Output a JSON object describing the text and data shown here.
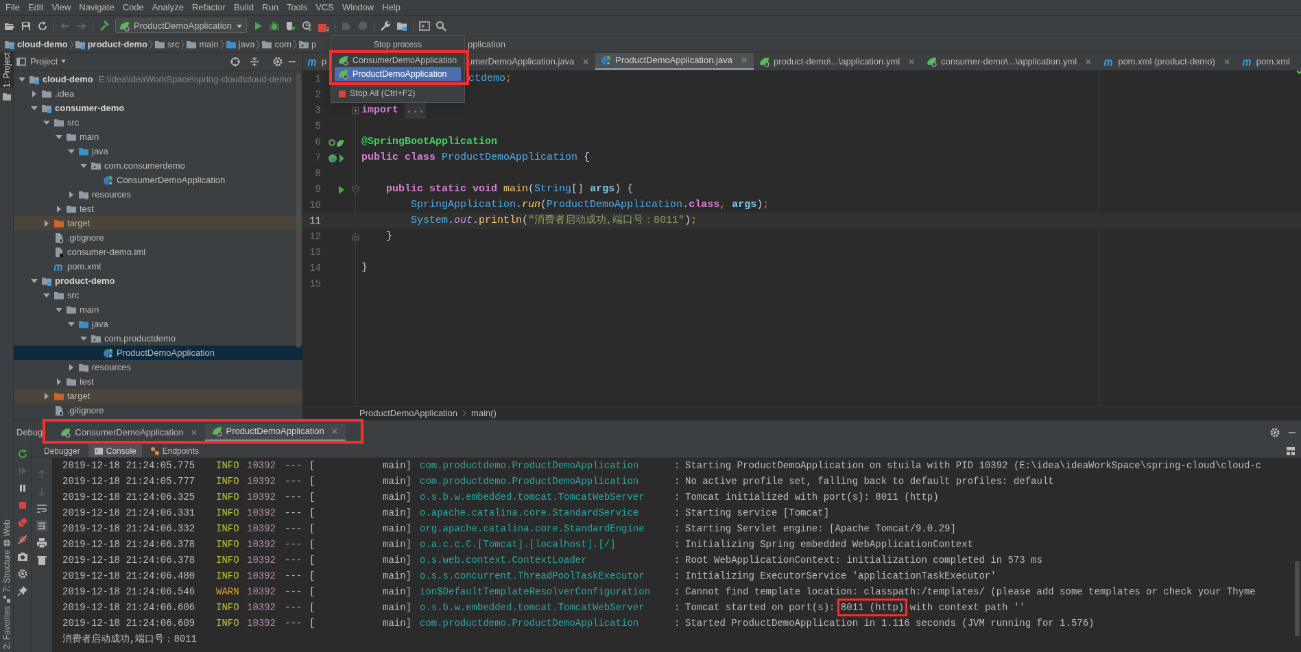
{
  "menu": [
    "File",
    "Edit",
    "View",
    "Navigate",
    "Code",
    "Analyze",
    "Refactor",
    "Build",
    "Run",
    "Tools",
    "VCS",
    "Window",
    "Help"
  ],
  "toolbar": {
    "run_config": "ProductDemoApplication",
    "stop_badge": "2"
  },
  "breadcrumbs": [
    {
      "label": "cloud-demo",
      "kind": "module"
    },
    {
      "label": "product-demo",
      "kind": "module"
    },
    {
      "label": "src",
      "kind": "folder"
    },
    {
      "label": "main",
      "kind": "folder"
    },
    {
      "label": "java",
      "kind": "source"
    },
    {
      "label": "com",
      "kind": "folder"
    },
    {
      "label": "p",
      "kind": "package"
    }
  ],
  "breadcrumb_tail": "pplication",
  "left_tool_windows": {
    "top": [
      {
        "label": "1: Project",
        "selected": true
      }
    ],
    "bottom": [
      {
        "label": "Web",
        "selected": false
      },
      {
        "label": "7: Structure",
        "selected": false
      },
      {
        "label": "2: Favorites",
        "selected": false
      }
    ]
  },
  "project": {
    "title": "Project",
    "tree": [
      {
        "kind": "module",
        "label": "cloud-demo",
        "path": "E:\\idea\\ideaWorkSpace\\spring-cloud\\cloud-demo",
        "expanded": true,
        "selected": false,
        "children": [
          {
            "kind": "folder",
            "label": ".idea",
            "expanded": false,
            "selected": false
          },
          {
            "kind": "module",
            "label": "consumer-demo",
            "expanded": true,
            "selected": false,
            "children": [
              {
                "kind": "folder",
                "label": "src",
                "expanded": true,
                "selected": false,
                "children": [
                  {
                    "kind": "folder",
                    "label": "main",
                    "expanded": true,
                    "selected": false,
                    "children": [
                      {
                        "kind": "source",
                        "label": "java",
                        "expanded": true,
                        "selected": false,
                        "children": [
                          {
                            "kind": "package",
                            "label": "com.consumerdemo",
                            "expanded": true,
                            "selected": false,
                            "children": [
                              {
                                "kind": "app",
                                "label": "ConsumerDemoApplication",
                                "selected": false
                              }
                            ]
                          }
                        ]
                      },
                      {
                        "kind": "resources",
                        "label": "resources",
                        "expanded": false,
                        "selected": false
                      }
                    ]
                  },
                  {
                    "kind": "folder",
                    "label": "test",
                    "expanded": false,
                    "selected": false
                  }
                ]
              },
              {
                "kind": "excluded",
                "label": "target",
                "expanded": false,
                "selected": false
              },
              {
                "kind": "ignore",
                "label": ".gitignore",
                "selected": false
              },
              {
                "kind": "iml",
                "label": "consumer-demo.iml",
                "selected": false
              },
              {
                "kind": "maven",
                "label": "pom.xml",
                "selected": false
              }
            ]
          },
          {
            "kind": "module",
            "label": "product-demo",
            "expanded": true,
            "selected": false,
            "children": [
              {
                "kind": "folder",
                "label": "src",
                "expanded": true,
                "selected": false,
                "children": [
                  {
                    "kind": "folder",
                    "label": "main",
                    "expanded": true,
                    "selected": false,
                    "children": [
                      {
                        "kind": "source",
                        "label": "java",
                        "expanded": true,
                        "selected": false,
                        "children": [
                          {
                            "kind": "package",
                            "label": "com.productdemo",
                            "expanded": true,
                            "selected": false,
                            "children": [
                              {
                                "kind": "app",
                                "label": "ProductDemoApplication",
                                "selected": true
                              }
                            ]
                          }
                        ]
                      },
                      {
                        "kind": "resources",
                        "label": "resources",
                        "expanded": false,
                        "selected": false
                      }
                    ]
                  },
                  {
                    "kind": "folder",
                    "label": "test",
                    "expanded": false,
                    "selected": false
                  }
                ]
              },
              {
                "kind": "excluded",
                "label": "target",
                "expanded": false,
                "selected": false
              },
              {
                "kind": "ignore",
                "label": ".gitignore",
                "selected": false
              }
            ]
          }
        ]
      }
    ]
  },
  "editor": {
    "tabs": [
      {
        "label": "p",
        "kind": "maven",
        "covered": true,
        "closable": false,
        "selected": false
      },
      {
        "label": "umerDemoApplication.java",
        "kind": "none",
        "covered": true,
        "closable": true,
        "selected": false
      },
      {
        "label": "ProductDemoApplication.java",
        "kind": "app",
        "covered": false,
        "closable": true,
        "selected": true
      },
      {
        "label": "product-demo\\...\\application.yml",
        "kind": "leaf",
        "covered": false,
        "closable": true,
        "selected": false
      },
      {
        "label": "consumer-demo\\...\\application.yml",
        "kind": "leaf",
        "covered": false,
        "closable": true,
        "selected": false
      },
      {
        "label": "pom.xml (product-demo)",
        "kind": "maven",
        "covered": false,
        "closable": true,
        "selected": false
      },
      {
        "label": "pom.xml",
        "kind": "maven",
        "covered": false,
        "closable": false,
        "selected": false
      }
    ],
    "lines": [
      {
        "number": "1",
        "covered": true,
        "current": false,
        "tokens": [
          {
            "kind": "type",
            "text": "ctdemo"
          },
          {
            "kind": "semi",
            "text": ";"
          }
        ]
      },
      {
        "number": "2",
        "current": false
      },
      {
        "number": "3",
        "current": false,
        "fold": {
          "kind": "plus"
        },
        "tokens": [
          {
            "kind": "kw",
            "text": "import "
          },
          {
            "kind": "folded",
            "text": "..."
          }
        ]
      },
      {
        "number": "5",
        "current": false
      },
      {
        "number": "6",
        "current": false,
        "gutter": {
          "kind": "beans"
        },
        "tokens": [
          {
            "kind": "ann",
            "text": "@SpringBootApplication"
          }
        ]
      },
      {
        "number": "7",
        "current": false,
        "gutter": {
          "kind": "app"
        },
        "tokens": [
          {
            "kind": "kw",
            "text": "public "
          },
          {
            "kind": "kw",
            "text": "class "
          },
          {
            "kind": "type",
            "text": "ProductDemoApplication "
          },
          {
            "kind": "plain",
            "text": "{"
          }
        ]
      },
      {
        "number": "8",
        "current": false
      },
      {
        "number": "9",
        "current": false,
        "gutter": {
          "kind": "run"
        },
        "fold": {
          "kind": "open"
        },
        "tokens": [
          {
            "kind": "kw",
            "text": "    public "
          },
          {
            "kind": "kw",
            "text": "static "
          },
          {
            "kind": "kw",
            "text": "void "
          },
          {
            "kind": "method",
            "text": "main"
          },
          {
            "kind": "plain",
            "text": "("
          },
          {
            "kind": "type",
            "text": "String"
          },
          {
            "kind": "plain",
            "text": "[] "
          },
          {
            "kind": "param",
            "text": "args"
          },
          {
            "kind": "plain",
            "text": ") {"
          }
        ]
      },
      {
        "number": "10",
        "current": false,
        "tokens": [
          {
            "kind": "type",
            "text": "        SpringApplication"
          },
          {
            "kind": "plain",
            "text": "."
          },
          {
            "kind": "call",
            "text": "run"
          },
          {
            "kind": "plain",
            "text": "("
          },
          {
            "kind": "type",
            "text": "ProductDemoApplication"
          },
          {
            "kind": "plain",
            "text": "."
          },
          {
            "kind": "kw",
            "text": "class"
          },
          {
            "kind": "semi",
            "text": ", "
          },
          {
            "kind": "param",
            "text": "args"
          },
          {
            "kind": "plain",
            "text": ")"
          },
          {
            "kind": "semi",
            "text": ";"
          }
        ]
      },
      {
        "number": "11",
        "current": true,
        "tokens": [
          {
            "kind": "type",
            "text": "        System"
          },
          {
            "kind": "plain",
            "text": "."
          },
          {
            "kind": "field",
            "text": "out"
          },
          {
            "kind": "plain",
            "text": "."
          },
          {
            "kind": "method",
            "text": "println"
          },
          {
            "kind": "plain",
            "text": "("
          },
          {
            "kind": "str",
            "text": "\"消费者启动成功,端口号：8011\""
          },
          {
            "kind": "plain",
            "text": ")"
          },
          {
            "kind": "semi",
            "text": ";"
          }
        ]
      },
      {
        "number": "12",
        "current": false,
        "fold": {
          "kind": "close"
        },
        "tokens": [
          {
            "kind": "plain",
            "text": "    }"
          }
        ]
      },
      {
        "number": "13",
        "current": false
      },
      {
        "number": "14",
        "current": false,
        "tokens": [
          {
            "kind": "plain",
            "text": "}"
          }
        ]
      },
      {
        "number": "15",
        "current": false
      }
    ],
    "breadcrumbs": [
      "ProductDemoApplication",
      "main()"
    ]
  },
  "popup": {
    "title": "Stop process",
    "items": [
      {
        "kind": "app",
        "label": "ConsumerDemoApplication",
        "selected": false
      },
      {
        "kind": "app",
        "label": "ProductDemoApplication",
        "selected": true
      },
      {
        "kind": "stop",
        "label": "Stop All (Ctrl+F2)",
        "selected": false
      }
    ]
  },
  "debug": {
    "title": "Debug",
    "tabs": [
      {
        "label": "ConsumerDemoApplication",
        "selected": false
      },
      {
        "label": "ProductDemoApplication",
        "selected": true
      }
    ],
    "subtabs": [
      {
        "label": "Debugger",
        "kind": "none",
        "selected": false
      },
      {
        "label": "Console",
        "kind": "console",
        "selected": true
      },
      {
        "label": "Endpoints",
        "kind": "endpoints",
        "selected": false
      }
    ],
    "console": [
      {
        "kind": "info",
        "time": "2019-12-18 21:24:05.775",
        "level": "INFO",
        "pid": "10392",
        "sep": "---",
        "bracket": "[",
        "thread": "main]",
        "logger": "com.productdemo.ProductDemoApplication",
        "colon": ":",
        "message": "Starting ProductDemoApplication on stuila with PID 10392 (E:\\idea\\ideaWorkSpace\\spring-cloud\\cloud-c"
      },
      {
        "kind": "info",
        "time": "2019-12-18 21:24:05.777",
        "level": "INFO",
        "pid": "10392",
        "sep": "---",
        "bracket": "[",
        "thread": "main]",
        "logger": "com.productdemo.ProductDemoApplication",
        "colon": ":",
        "message": "No active profile set, falling back to default profiles: default"
      },
      {
        "kind": "info",
        "time": "2019-12-18 21:24:06.325",
        "level": "INFO",
        "pid": "10392",
        "sep": "---",
        "bracket": "[",
        "thread": "main]",
        "logger": "o.s.b.w.embedded.tomcat.TomcatWebServer",
        "colon": ":",
        "message": "Tomcat initialized with port(s): 8011 (http)"
      },
      {
        "kind": "info",
        "time": "2019-12-18 21:24:06.331",
        "level": "INFO",
        "pid": "10392",
        "sep": "---",
        "bracket": "[",
        "thread": "main]",
        "logger": "o.apache.catalina.core.StandardService",
        "colon": ":",
        "message": "Starting service [Tomcat]"
      },
      {
        "kind": "info",
        "time": "2019-12-18 21:24:06.332",
        "level": "INFO",
        "pid": "10392",
        "sep": "---",
        "bracket": "[",
        "thread": "main]",
        "logger": "org.apache.catalina.core.StandardEngine",
        "colon": ":",
        "message": "Starting Servlet engine: [Apache Tomcat/9.0.29]"
      },
      {
        "kind": "info",
        "time": "2019-12-18 21:24:06.378",
        "level": "INFO",
        "pid": "10392",
        "sep": "---",
        "bracket": "[",
        "thread": "main]",
        "logger": "o.a.c.c.C.[Tomcat].[localhost].[/]",
        "colon": ":",
        "message": "Initializing Spring embedded WebApplicationContext"
      },
      {
        "kind": "info",
        "time": "2019-12-18 21:24:06.378",
        "level": "INFO",
        "pid": "10392",
        "sep": "---",
        "bracket": "[",
        "thread": "main]",
        "logger": "o.s.web.context.ContextLoader",
        "colon": ":",
        "message": "Root WebApplicationContext: initialization completed in 573 ms"
      },
      {
        "kind": "info",
        "time": "2019-12-18 21:24:06.480",
        "level": "INFO",
        "pid": "10392",
        "sep": "---",
        "bracket": "[",
        "thread": "main]",
        "logger": "o.s.s.concurrent.ThreadPoolTaskExecutor",
        "colon": ":",
        "message": "Initializing ExecutorService 'applicationTaskExecutor'"
      },
      {
        "kind": "warn",
        "time": "2019-12-18 21:24:06.546",
        "level": "WARN",
        "pid": "10392",
        "sep": "---",
        "bracket": "[",
        "thread": "main]",
        "logger": "ion$DefaultTemplateResolverConfiguration",
        "colon": ":",
        "message": "Cannot find template location: classpath:/templates/ (please add some templates or check your Thyme"
      },
      {
        "kind": "info",
        "time": "2019-12-18 21:24:06.606",
        "level": "INFO",
        "pid": "10392",
        "sep": "---",
        "bracket": "[",
        "thread": "main]",
        "logger": "o.s.b.w.embedded.tomcat.TomcatWebServer",
        "colon": ":",
        "message_parts": [
          {
            "text": "Tomcat started on port(s): ",
            "framed": false
          },
          {
            "text": "8011 (http)",
            "framed": true
          },
          {
            "text": " with context path ''",
            "framed": false
          }
        ]
      },
      {
        "kind": "info",
        "time": "2019-12-18 21:24:06.609",
        "level": "INFO",
        "pid": "10392",
        "sep": "---",
        "bracket": "[",
        "thread": "main]",
        "logger": "com.productdemo.ProductDemoApplication",
        "colon": ":",
        "message": "Started ProductDemoApplication in 1.116 seconds (JVM running for 1.576)"
      },
      {
        "kind": "output",
        "message": "消费者启动成功,端口号：8011"
      }
    ]
  }
}
